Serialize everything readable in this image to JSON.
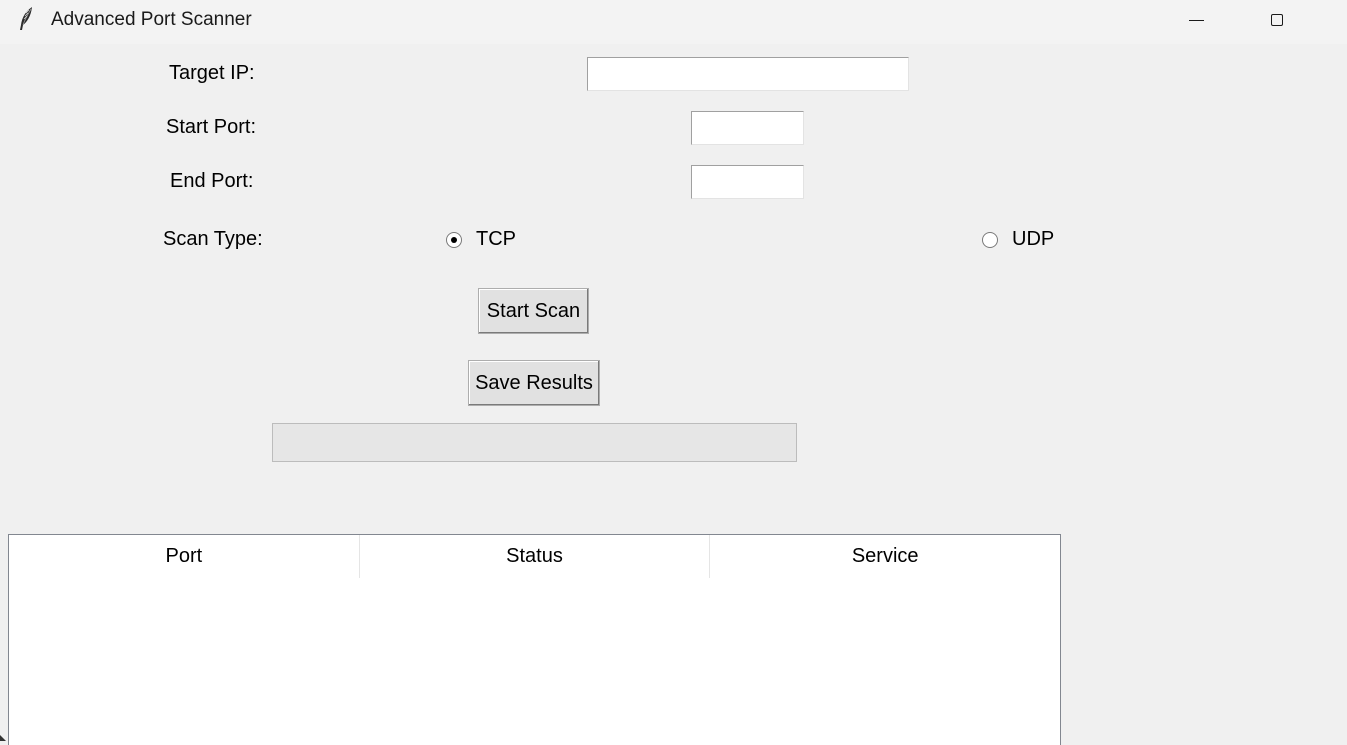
{
  "window": {
    "title": "Advanced Port Scanner",
    "icon": "feather-icon"
  },
  "form": {
    "target_ip_label": "Target IP:",
    "target_ip_value": "",
    "start_port_label": "Start Port:",
    "start_port_value": "",
    "end_port_label": "End Port:",
    "end_port_value": "",
    "scan_type_label": "Scan Type:",
    "scan_types": [
      {
        "label": "TCP",
        "checked": true
      },
      {
        "label": "UDP",
        "checked": false
      }
    ]
  },
  "buttons": {
    "start_scan": "Start Scan",
    "save_results": "Save Results"
  },
  "progress": {
    "value": 0
  },
  "results_table": {
    "columns": [
      "Port",
      "Status",
      "Service"
    ],
    "rows": []
  }
}
